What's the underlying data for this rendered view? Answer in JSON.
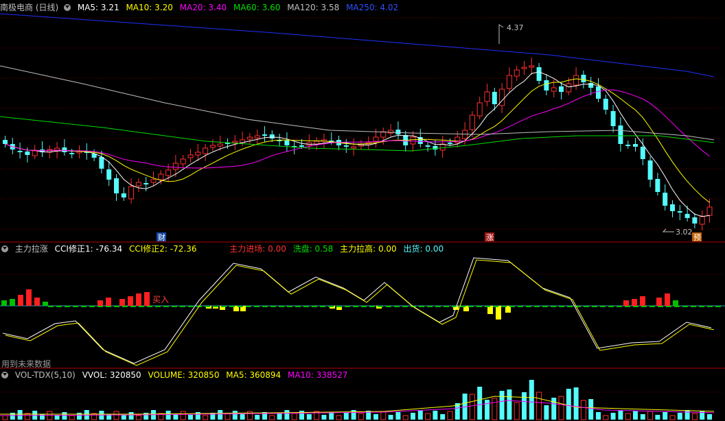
{
  "header_main": {
    "title": "南极电商 (日线)",
    "ma5": "MA5: 3.21",
    "ma10": "MA10: 3.20",
    "ma20": "MA20: 3.40",
    "ma60": "MA60: 3.60",
    "ma120": "MA120: 3.58",
    "ma250": "MA250: 4.02"
  },
  "header_cci": {
    "name": "主力拉涨",
    "cci1": "CCI修正1: -76.34",
    "cci2": "CCI修正2: -72.36",
    "enter": "主力进场: 0.00",
    "wash": "洗盘: 0.58",
    "pull": "主力拉高: 0.00",
    "ship": "出货: 0.00"
  },
  "header_vol": {
    "name": "VOL-TDX(5,10)",
    "vvol": "VVOL: 320850",
    "volume": "VOLUME: 320850",
    "ma5": "MA5: 360894",
    "ma10": "MA10: 338527"
  },
  "annotations": {
    "high": "4.37",
    "low": "3.02",
    "cai": "财",
    "zhang": "涨",
    "yu": "预",
    "buy": "买入",
    "future": "用到未来数据"
  },
  "colors": {
    "ma5": "#ffffff",
    "ma10": "#ffff00",
    "ma20": "#ff00ff",
    "ma60": "#00e000",
    "ma120": "#c0c0c0",
    "ma250": "#0000ff",
    "up": "#ff3030",
    "down": "#54fcfc"
  }
}
